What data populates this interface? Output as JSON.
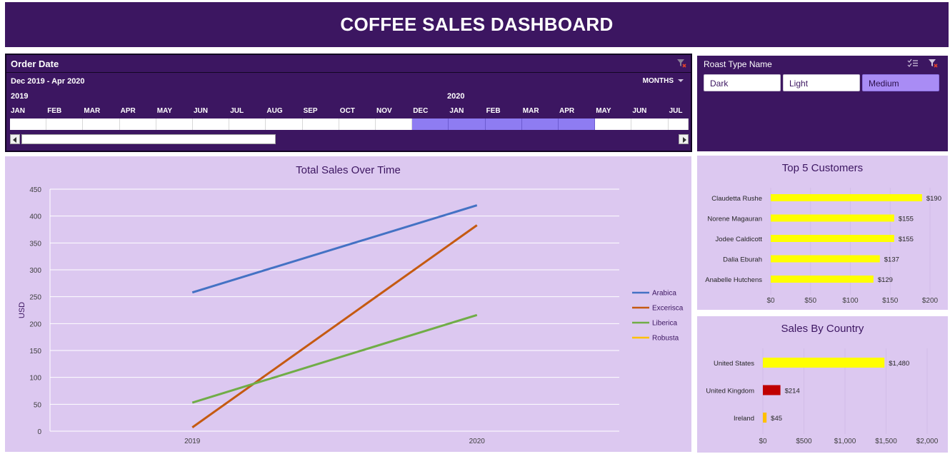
{
  "header": {
    "title": "COFFEE SALES DASHBOARD"
  },
  "timeline": {
    "title": "Order Date",
    "range_label": "Dec 2019 - Apr  2020",
    "level_label": "MONTHS",
    "years": [
      "2019",
      "2020"
    ],
    "months": [
      "JAN",
      "FEB",
      "MAR",
      "APR",
      "MAY",
      "JUN",
      "JUL",
      "AUG",
      "SEP",
      "OCT",
      "NOV",
      "DEC",
      "JAN",
      "FEB",
      "MAR",
      "APR",
      "MAY",
      "JUN",
      "JUL"
    ],
    "selected_months": [
      false,
      false,
      false,
      false,
      false,
      false,
      false,
      false,
      false,
      false,
      false,
      true,
      true,
      true,
      true,
      true,
      false,
      false,
      false
    ],
    "selected_color": "#8e7cf2",
    "clear_filter_icon": "clear-filter-icon"
  },
  "roast": {
    "title": "Roast Type Name",
    "options": [
      {
        "label": "Dark",
        "selected": false
      },
      {
        "label": "Light",
        "selected": false
      },
      {
        "label": "Medium",
        "selected": true
      }
    ],
    "multiselect_icon": "multi-select-icon",
    "clear_filter_icon": "clear-filter-icon"
  },
  "colors": {
    "header_bg": "#3c1661",
    "panel_bg": "#dcc8f0",
    "accent_selected": "#a98cf5"
  },
  "chart_data": [
    {
      "type": "line",
      "title": "Total Sales Over Time",
      "xlabel": "",
      "ylabel": "USD",
      "categories": [
        "2019",
        "2020"
      ],
      "ylim": [
        0,
        450
      ],
      "yticks": [
        0,
        50,
        100,
        150,
        200,
        250,
        300,
        350,
        400,
        450
      ],
      "grid": true,
      "legend_position": "right",
      "series": [
        {
          "name": "Arabica",
          "values": [
            258,
            420
          ],
          "color": "#4472c4"
        },
        {
          "name": "Excerisca",
          "values": [
            7,
            383
          ],
          "color": "#c55a11"
        },
        {
          "name": "Liberica",
          "values": [
            53,
            216
          ],
          "color": "#70ad47"
        },
        {
          "name": "Robusta",
          "values": [
            null,
            null
          ],
          "color": "#ffc000"
        }
      ]
    },
    {
      "type": "bar",
      "orientation": "horizontal",
      "title": "Top 5 Customers",
      "categories": [
        "Claudetta Rushe",
        "Norene Magauran",
        "Jodee Caldicott",
        "Dalia Eburah",
        "Anabelle Hutchens"
      ],
      "values": [
        190,
        155,
        155,
        137,
        129
      ],
      "value_labels": [
        "$190",
        "$155",
        "$155",
        "$137",
        "$129"
      ],
      "xlim": [
        0,
        200
      ],
      "xticks": [
        "$0",
        "$50",
        "$100",
        "$150",
        "$200"
      ],
      "xtick_values": [
        0,
        50,
        100,
        150,
        200
      ],
      "bar_color": "#ffff00"
    },
    {
      "type": "bar",
      "orientation": "horizontal",
      "title": "Sales By Country",
      "categories": [
        "United States",
        "United Kingdom",
        "Ireland"
      ],
      "values": [
        1480,
        214,
        45
      ],
      "value_labels": [
        "$1,480",
        "$214",
        "$45"
      ],
      "xlim": [
        0,
        2000
      ],
      "xticks": [
        "$0",
        "$500",
        "$1,000",
        "$1,500",
        "$2,000"
      ],
      "xtick_values": [
        0,
        500,
        1000,
        1500,
        2000
      ],
      "bar_colors": [
        "#ffff00",
        "#c00000",
        "#ffc000"
      ]
    }
  ]
}
